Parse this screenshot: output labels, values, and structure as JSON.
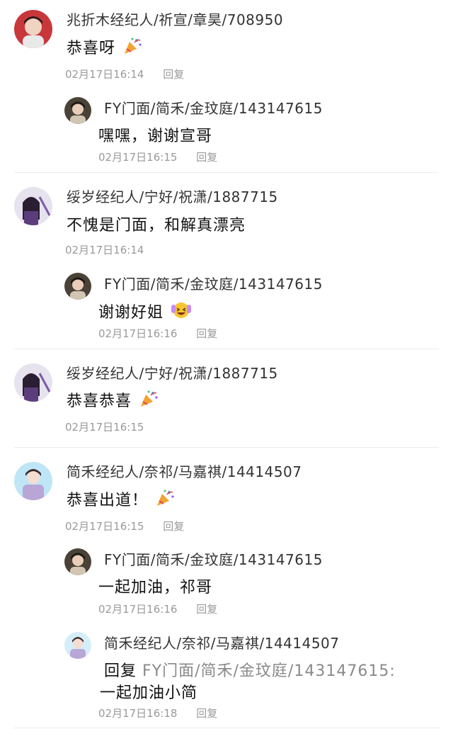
{
  "comments": [
    {
      "name": "兆折木经纪人/祈宣/章昊/708950",
      "text": "恭喜呀",
      "time": "02月17日16:14",
      "reply_label": "回复",
      "emoji": "party-popper",
      "replies": [
        {
          "name": "FY门面/简禾/金玟庭/143147615",
          "text": "嘿嘿，谢谢宣哥",
          "time": "02月17日16:15",
          "reply_label": "回复"
        }
      ]
    },
    {
      "name": "绥岁经纪人/宁好/祝潇/1887715",
      "text": "不愧是门面，和解真漂亮",
      "time": "02月17日16:14",
      "replies": [
        {
          "name": "FY门面/简禾/金玟庭/143147615",
          "text": "谢谢好姐",
          "time": "02月17日16:16",
          "reply_label": "回复",
          "emoji": "laughing-face"
        }
      ]
    },
    {
      "name": "绥岁经纪人/宁好/祝潇/1887715",
      "text": "恭喜恭喜",
      "time": "02月17日16:15",
      "emoji": "party-popper"
    },
    {
      "name": "简禾经纪人/奈祁/马嘉祺/14414507",
      "text": "恭喜出道！",
      "time": "02月17日16:15",
      "reply_label": "回复",
      "emoji": "party-popper",
      "replies": [
        {
          "name": "FY门面/简禾/金玟庭/143147615",
          "text": "一起加油，祁哥",
          "time": "02月17日16:16",
          "reply_label": "回复"
        },
        {
          "name": "简禾经纪人/奈祁/马嘉祺/14414507",
          "reply_prefix": "回复",
          "reply_target": "FY门面/简禾/金玟庭/143147615:",
          "text": "一起加油小简",
          "time": "02月17日16:18",
          "reply_label": "回复"
        }
      ]
    }
  ],
  "colors": {
    "name": "#333333",
    "meta": "#9a9a9a",
    "divider": "#ececec"
  }
}
